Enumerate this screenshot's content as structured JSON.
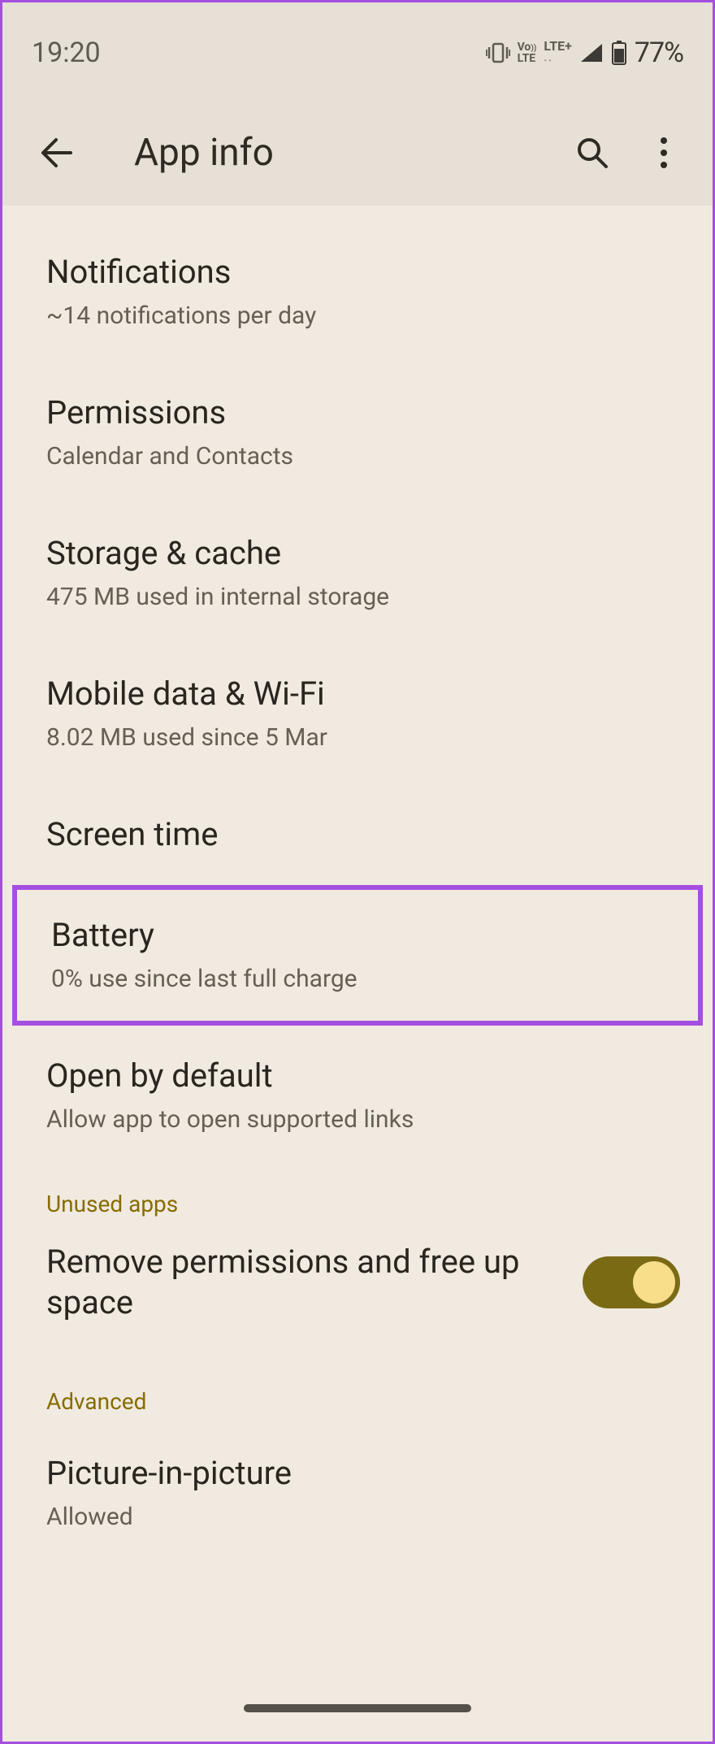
{
  "status": {
    "time": "19:20",
    "battery_text": "77%"
  },
  "header": {
    "title": "App info"
  },
  "items": {
    "notifications": {
      "title": "Notifications",
      "sub": "~14 notifications per day"
    },
    "permissions": {
      "title": "Permissions",
      "sub": "Calendar and Contacts"
    },
    "storage": {
      "title": "Storage & cache",
      "sub": "475 MB used in internal storage"
    },
    "mobile": {
      "title": "Mobile data & Wi-Fi",
      "sub": "8.02 MB used since 5 Mar"
    },
    "screentime": {
      "title": "Screen time"
    },
    "battery": {
      "title": "Battery",
      "sub": "0% use since last full charge"
    },
    "openby": {
      "title": "Open by default",
      "sub": "Allow app to open supported links"
    },
    "pip": {
      "title": "Picture-in-picture",
      "sub": "Allowed"
    }
  },
  "sections": {
    "unused": "Unused apps",
    "advanced": "Advanced"
  },
  "toggle": {
    "label": "Remove permissions and free up space",
    "on": true
  }
}
